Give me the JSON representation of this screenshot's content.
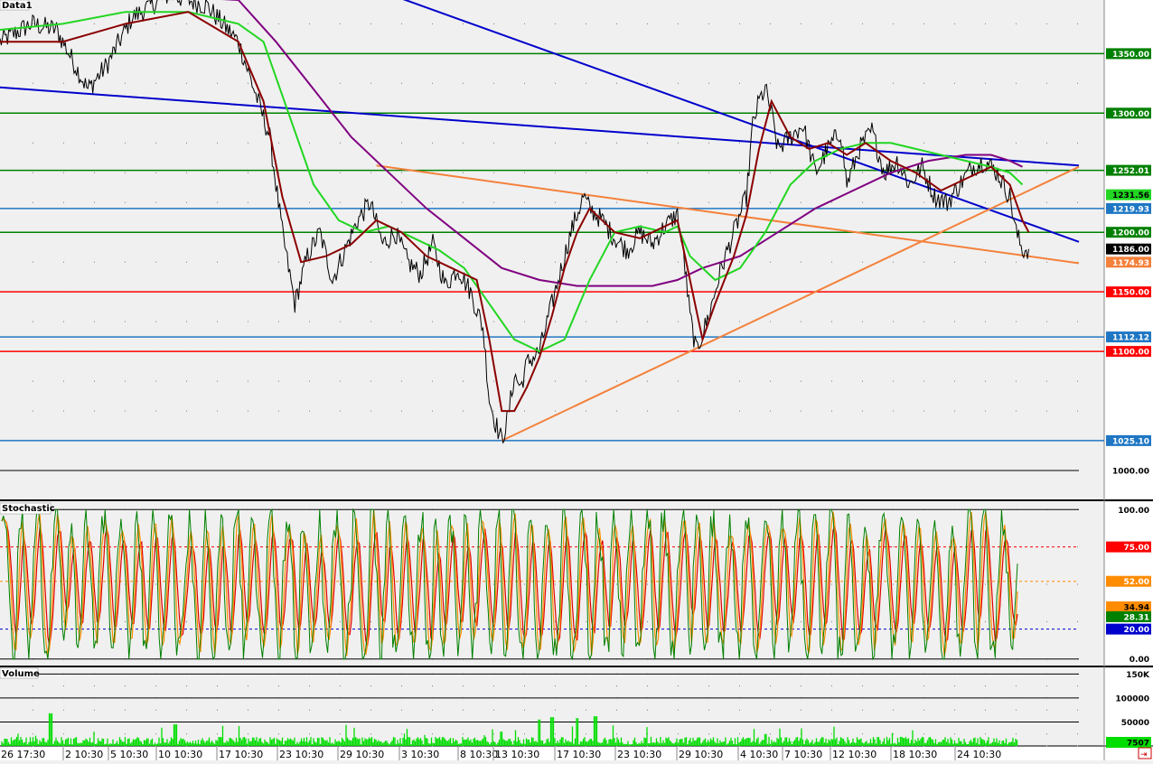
{
  "panels": {
    "price_title": "Data1",
    "stochastic_title": "Stochastic",
    "volume_title": "Volume"
  },
  "price_axis": {
    "min": 975,
    "max": 1395,
    "ticks": [
      "1000.00"
    ]
  },
  "stoch_axis": {
    "min": -5,
    "max": 105,
    "ticks": [
      "100.00",
      "0.00"
    ]
  },
  "volume_axis": {
    "min": 0,
    "max": 162000,
    "ticks": [
      "150K",
      "100000",
      "50000"
    ]
  },
  "time_labels": [
    "26 17:30",
    "2 10:30",
    "5 10:30",
    "10 10:30",
    "17 10:30",
    "23 10:30",
    "29 10:30",
    "3 10:30",
    "8 10:30",
    "13 10:30",
    "17 10:30",
    "23 10:30",
    "29 10:30",
    "4 10:30",
    "7 10:30",
    "12 10:30",
    "18 10:30",
    "24 10:30"
  ],
  "colors": {
    "panel_bg": "#f0f0f0",
    "axis_bg": "#ffffff",
    "green_level": "#008000",
    "red_level": "#ff0000",
    "blue_level": "#1f77c4",
    "trend_blue": "#0000cc",
    "trend_orange": "#f4813b",
    "ma_fast": "#8b0000",
    "ma_mid": "#22d622",
    "ma_slow": "#800080",
    "stoch_k": "#008000",
    "stoch_d": "#ff8c00",
    "stoch_slow": "#e00000",
    "volume": "#00dd00"
  },
  "chart_data": [
    {
      "type": "line",
      "title": "Data1",
      "ylim": [
        975,
        1395
      ],
      "x_categories": [
        "26 17:30",
        "2 10:30",
        "5 10:30",
        "10 10:30",
        "17 10:30",
        "23 10:30",
        "29 10:30",
        "3 10:30",
        "8 10:30",
        "13 10:30",
        "17 10:30",
        "23 10:30",
        "29 10:30",
        "4 10:30",
        "7 10:30",
        "12 10:30",
        "18 10:30",
        "24 10:30"
      ],
      "price_path": [
        [
          0,
          1360
        ],
        [
          5,
          1375
        ],
        [
          9,
          1370
        ],
        [
          11,
          1350
        ],
        [
          14,
          1320
        ],
        [
          17,
          1340
        ],
        [
          21,
          1380
        ],
        [
          27,
          1400
        ],
        [
          33,
          1390
        ],
        [
          38,
          1360
        ],
        [
          43,
          1280
        ],
        [
          45,
          1200
        ],
        [
          47,
          1140
        ],
        [
          49,
          1180
        ],
        [
          51,
          1200
        ],
        [
          53,
          1160
        ],
        [
          55,
          1185
        ],
        [
          57,
          1210
        ],
        [
          59,
          1225
        ],
        [
          61,
          1190
        ],
        [
          63,
          1200
        ],
        [
          65,
          1175
        ],
        [
          67,
          1165
        ],
        [
          69,
          1190
        ],
        [
          71,
          1155
        ],
        [
          73,
          1170
        ],
        [
          75,
          1150
        ],
        [
          77,
          1120
        ],
        [
          78,
          1060
        ],
        [
          79,
          1040
        ],
        [
          80,
          1025
        ],
        [
          81,
          1045
        ],
        [
          82,
          1080
        ],
        [
          83,
          1070
        ],
        [
          84,
          1090
        ],
        [
          86,
          1100
        ],
        [
          88,
          1140
        ],
        [
          90,
          1180
        ],
        [
          91,
          1200
        ],
        [
          93,
          1230
        ],
        [
          94,
          1220
        ],
        [
          96,
          1210
        ],
        [
          98,
          1195
        ],
        [
          100,
          1185
        ],
        [
          102,
          1200
        ],
        [
          104,
          1190
        ],
        [
          106,
          1205
        ],
        [
          108,
          1215
        ],
        [
          109,
          1180
        ],
        [
          110,
          1130
        ],
        [
          111,
          1100
        ],
        [
          113,
          1130
        ],
        [
          115,
          1170
        ],
        [
          117,
          1200
        ],
        [
          119,
          1230
        ],
        [
          120,
          1290
        ],
        [
          121,
          1310
        ],
        [
          122,
          1320
        ],
        [
          123,
          1300
        ],
        [
          124,
          1270
        ],
        [
          126,
          1280
        ],
        [
          128,
          1290
        ],
        [
          130,
          1250
        ],
        [
          132,
          1270
        ],
        [
          134,
          1285
        ],
        [
          135,
          1240
        ],
        [
          137,
          1270
        ],
        [
          139,
          1285
        ],
        [
          141,
          1250
        ],
        [
          143,
          1260
        ],
        [
          145,
          1240
        ],
        [
          147,
          1255
        ],
        [
          149,
          1230
        ],
        [
          151,
          1225
        ],
        [
          153,
          1240
        ],
        [
          155,
          1255
        ],
        [
          157,
          1260
        ],
        [
          159,
          1250
        ],
        [
          161,
          1230
        ],
        [
          162,
          1200
        ],
        [
          163,
          1185
        ],
        [
          164,
          1186
        ]
      ],
      "moving_averages": {
        "fast": [
          [
            0,
            1360
          ],
          [
            10,
            1360
          ],
          [
            20,
            1375
          ],
          [
            30,
            1385
          ],
          [
            38,
            1360
          ],
          [
            42,
            1310
          ],
          [
            45,
            1230
          ],
          [
            48,
            1175
          ],
          [
            52,
            1180
          ],
          [
            56,
            1190
          ],
          [
            60,
            1210
          ],
          [
            64,
            1200
          ],
          [
            68,
            1180
          ],
          [
            72,
            1170
          ],
          [
            76,
            1160
          ],
          [
            78,
            1110
          ],
          [
            80,
            1050
          ],
          [
            82,
            1050
          ],
          [
            84,
            1070
          ],
          [
            86,
            1095
          ],
          [
            88,
            1130
          ],
          [
            90,
            1170
          ],
          [
            92,
            1200
          ],
          [
            94,
            1220
          ],
          [
            98,
            1200
          ],
          [
            102,
            1195
          ],
          [
            106,
            1205
          ],
          [
            108,
            1210
          ],
          [
            110,
            1160
          ],
          [
            112,
            1110
          ],
          [
            114,
            1140
          ],
          [
            117,
            1180
          ],
          [
            119,
            1215
          ],
          [
            121,
            1270
          ],
          [
            123,
            1310
          ],
          [
            126,
            1280
          ],
          [
            129,
            1270
          ],
          [
            132,
            1275
          ],
          [
            135,
            1265
          ],
          [
            138,
            1275
          ],
          [
            142,
            1260
          ],
          [
            146,
            1250
          ],
          [
            150,
            1235
          ],
          [
            154,
            1245
          ],
          [
            158,
            1255
          ],
          [
            161,
            1240
          ],
          [
            163,
            1210
          ],
          [
            164,
            1200
          ]
        ],
        "mid": [
          [
            0,
            1370
          ],
          [
            10,
            1375
          ],
          [
            20,
            1385
          ],
          [
            30,
            1385
          ],
          [
            38,
            1375
          ],
          [
            42,
            1360
          ],
          [
            46,
            1300
          ],
          [
            50,
            1240
          ],
          [
            54,
            1210
          ],
          [
            58,
            1200
          ],
          [
            62,
            1205
          ],
          [
            66,
            1195
          ],
          [
            70,
            1185
          ],
          [
            74,
            1170
          ],
          [
            78,
            1140
          ],
          [
            82,
            1110
          ],
          [
            86,
            1100
          ],
          [
            90,
            1110
          ],
          [
            94,
            1160
          ],
          [
            98,
            1200
          ],
          [
            102,
            1205
          ],
          [
            106,
            1200
          ],
          [
            108,
            1205
          ],
          [
            110,
            1180
          ],
          [
            114,
            1160
          ],
          [
            118,
            1170
          ],
          [
            122,
            1200
          ],
          [
            126,
            1240
          ],
          [
            130,
            1260
          ],
          [
            134,
            1270
          ],
          [
            138,
            1275
          ],
          [
            142,
            1275
          ],
          [
            146,
            1270
          ],
          [
            150,
            1265
          ],
          [
            154,
            1260
          ],
          [
            158,
            1255
          ],
          [
            161,
            1250
          ],
          [
            163,
            1240
          ]
        ],
        "slow": [
          [
            0,
            1395
          ],
          [
            20,
            1400
          ],
          [
            38,
            1395
          ],
          [
            44,
            1360
          ],
          [
            50,
            1320
          ],
          [
            56,
            1280
          ],
          [
            62,
            1250
          ],
          [
            68,
            1220
          ],
          [
            74,
            1195
          ],
          [
            80,
            1170
          ],
          [
            86,
            1160
          ],
          [
            92,
            1155
          ],
          [
            98,
            1155
          ],
          [
            104,
            1155
          ],
          [
            108,
            1160
          ],
          [
            112,
            1170
          ],
          [
            118,
            1180
          ],
          [
            124,
            1200
          ],
          [
            130,
            1220
          ],
          [
            136,
            1235
          ],
          [
            142,
            1250
          ],
          [
            148,
            1260
          ],
          [
            154,
            1265
          ],
          [
            158,
            1265
          ],
          [
            161,
            1260
          ],
          [
            163,
            1255
          ]
        ]
      },
      "horizontal_levels": [
        {
          "value": 1350.0,
          "label": "1350.00",
          "color": "#008000"
        },
        {
          "value": 1300.0,
          "label": "1300.00",
          "color": "#008000"
        },
        {
          "value": 1252.01,
          "label": "1252.01",
          "color": "#008000"
        },
        {
          "value": 1219.93,
          "label": "1219.93",
          "color": "#1f77c4"
        },
        {
          "value": 1200.0,
          "label": "1200.00",
          "color": "#008000"
        },
        {
          "value": 1150.0,
          "label": "1150.00",
          "color": "#ff0000"
        },
        {
          "value": 1112.12,
          "label": "1112.12",
          "color": "#1f77c4"
        },
        {
          "value": 1100.0,
          "label": "1100.00",
          "color": "#ff0000"
        },
        {
          "value": 1025.1,
          "label": "1025.10",
          "color": "#1f77c4"
        }
      ],
      "last_values": [
        {
          "value": 1231.56,
          "label": "1231.56",
          "color": "#22d622"
        },
        {
          "value": 1186.0,
          "label": "1186.00",
          "color": "#000000"
        },
        {
          "value": 1174.93,
          "label": "1174.93",
          "color": "#f4813b"
        }
      ],
      "trendlines": [
        {
          "color": "#0000cc",
          "from": [
            -1,
            1322
          ],
          "to": [
            172,
            1256
          ]
        },
        {
          "color": "#0000cc",
          "from": [
            62,
            1400
          ],
          "to": [
            172,
            1192
          ]
        },
        {
          "color": "#f4813b",
          "from": [
            60,
            1256
          ],
          "to": [
            172,
            1174
          ]
        },
        {
          "color": "#f4813b",
          "from": [
            80,
            1025
          ],
          "to": [
            172,
            1255
          ]
        }
      ]
    },
    {
      "type": "line",
      "title": "Stochastic",
      "ylim": [
        0,
        100
      ],
      "levels": [
        {
          "value": 100,
          "label": "100.00",
          "style": "solid"
        },
        {
          "value": 75,
          "label": "75.00",
          "style": "dashed",
          "color": "#ff0000"
        },
        {
          "value": 52,
          "label": "52.00",
          "style": "dashed",
          "color": "#ff8c00"
        },
        {
          "value": 20,
          "label": "20.00",
          "style": "dashed",
          "color": "#0000cc"
        },
        {
          "value": 0,
          "label": "0.00",
          "style": "solid"
        }
      ],
      "last_values": [
        {
          "value": 34.94,
          "label": "34.94",
          "color": "#ff8c00"
        },
        {
          "value": 28.31,
          "label": "28.31",
          "color": "#008000"
        }
      ],
      "series_shape": "oscillating between 0 and 100 across whole period"
    },
    {
      "type": "bar",
      "title": "Volume",
      "ylim": [
        0,
        162000
      ],
      "last_value": {
        "value": 7507,
        "label": "7507"
      },
      "spikes": [
        [
          8,
          68000
        ],
        [
          28,
          45000
        ],
        [
          86,
          55000
        ],
        [
          88,
          60000
        ],
        [
          92,
          58000
        ],
        [
          95,
          62000
        ],
        [
          80,
          30000
        ],
        [
          122,
          25000
        ]
      ],
      "baseline": 10000
    }
  ]
}
